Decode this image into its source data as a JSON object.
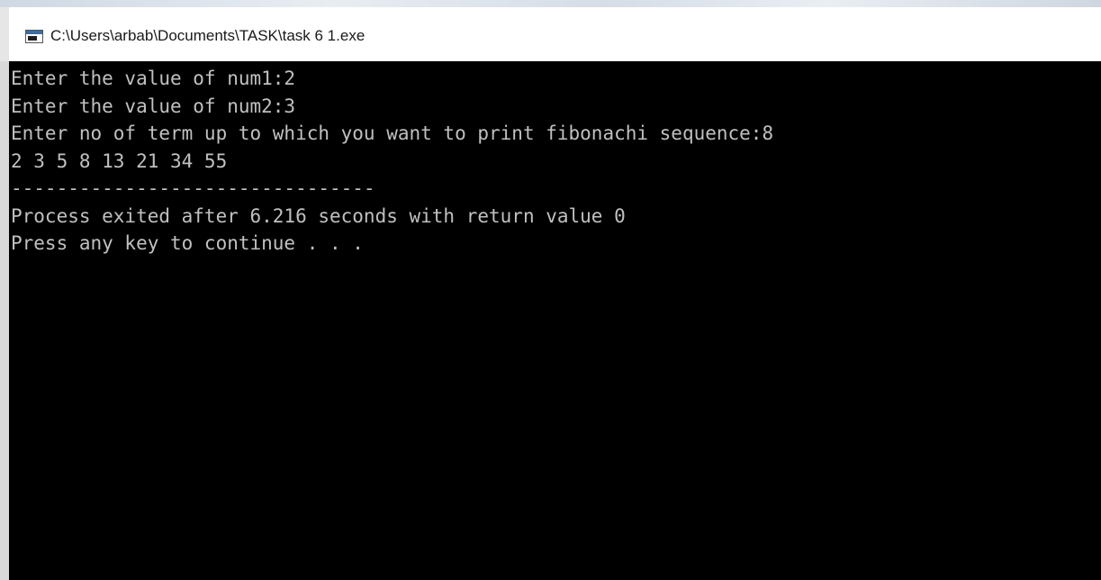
{
  "window": {
    "title": "C:\\Users\\arbab\\Documents\\TASK\\task 6 1.exe",
    "icon": "console-app-icon"
  },
  "console": {
    "lines": [
      "Enter the value of num1:2",
      "Enter the value of num2:3",
      "Enter no of term up to which you want to print fibonachi sequence:8",
      "2 3 5 8 13 21 34 55",
      "--------------------------------",
      "Process exited after 6.216 seconds with return value 0",
      "Press any key to continue . . ."
    ],
    "background": "#000000",
    "foreground": "#c0c0c0"
  }
}
